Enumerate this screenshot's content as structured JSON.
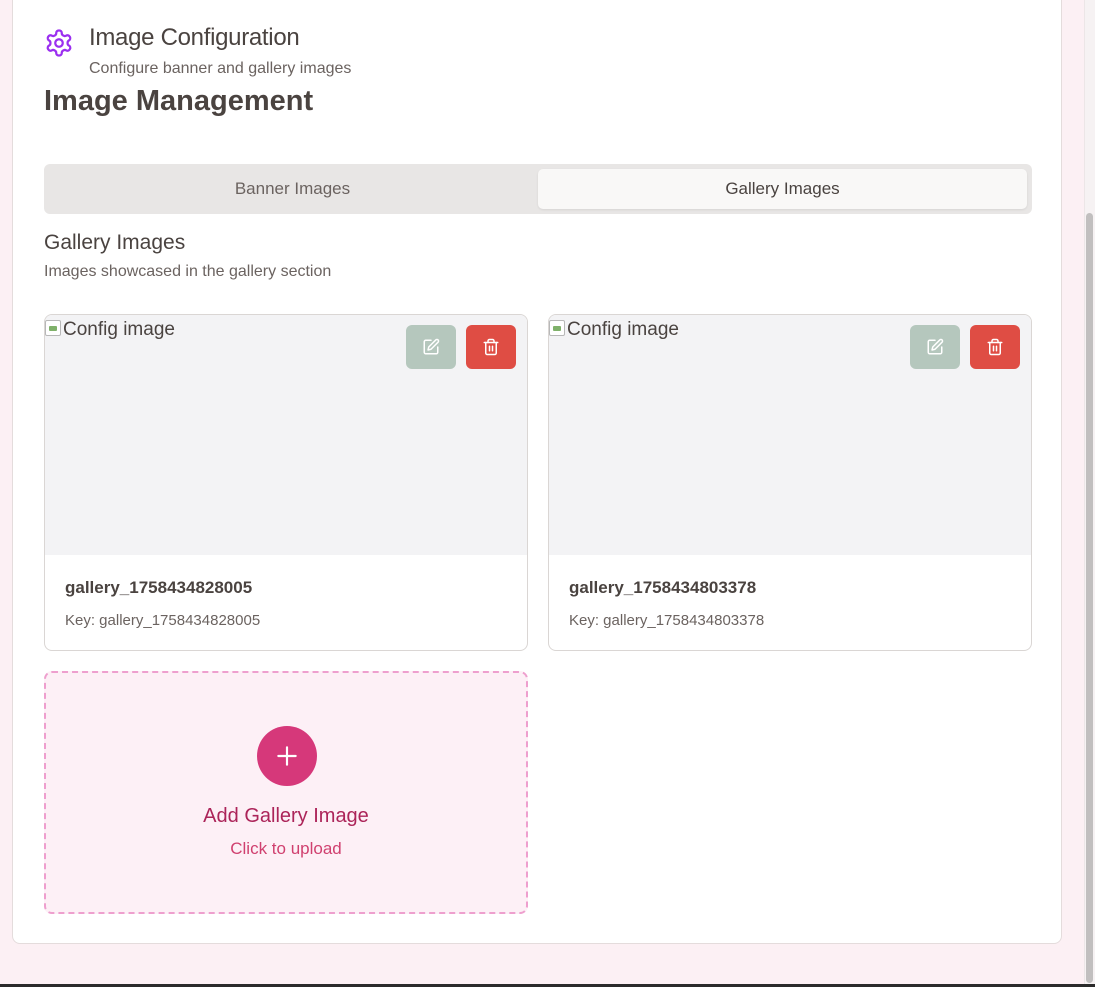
{
  "header": {
    "icon": "gear-icon",
    "accent_color": "#9b2ff0",
    "title": "Image Configuration",
    "subtitle": "Configure banner and gallery images"
  },
  "page_title": "Image Management",
  "tabs": [
    {
      "label": "Banner Images",
      "active": false
    },
    {
      "label": "Gallery Images",
      "active": true
    }
  ],
  "section": {
    "title": "Gallery Images",
    "subtitle": "Images showcased in the gallery section"
  },
  "images": [
    {
      "alt": "Config image",
      "name": "gallery_1758434828005",
      "key_text": "Key: gallery_1758434828005"
    },
    {
      "alt": "Config image",
      "name": "gallery_1758434803378",
      "key_text": "Key: gallery_1758434803378"
    }
  ],
  "add_card": {
    "icon": "plus-icon",
    "title": "Add Gallery Image",
    "subtitle": "Click to upload"
  },
  "colors": {
    "edit_button": "#b5c7bd",
    "delete_button": "#df4d44",
    "add_accent": "#d6387a"
  }
}
